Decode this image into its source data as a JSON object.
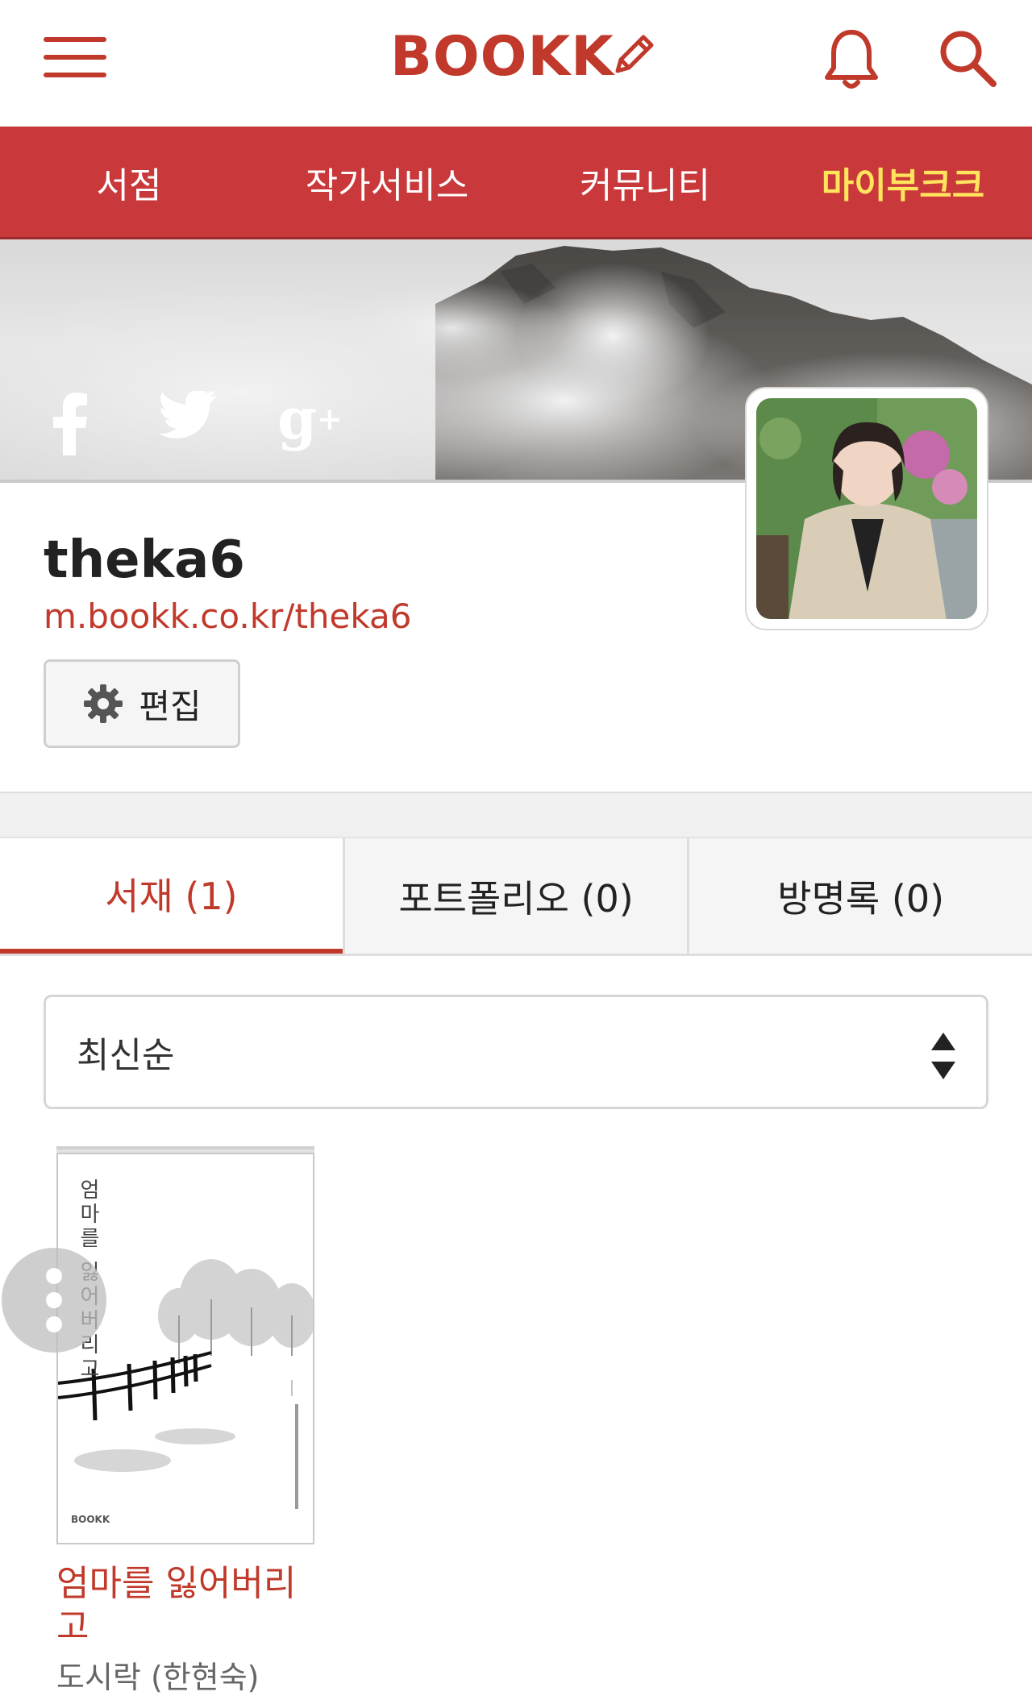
{
  "header": {
    "logo_text": "BOOKK",
    "menu_icon": "hamburger-menu-icon",
    "notification_icon": "bell-icon",
    "search_icon": "search-icon",
    "brand_color": "#c0392b"
  },
  "nav": {
    "items": [
      {
        "label": "서점"
      },
      {
        "label": "작가서비스"
      },
      {
        "label": "커뮤니티"
      },
      {
        "label": "마이부크크",
        "active": true
      }
    ],
    "bg_color": "#c9383a",
    "active_color": "#ffe45c"
  },
  "cover": {
    "social_icons": [
      "facebook-icon",
      "twitter-icon",
      "google-plus-icon"
    ]
  },
  "profile": {
    "username": "theka6",
    "url": "m.bookk.co.kr/theka6",
    "edit_label": "편집",
    "edit_icon": "gear-icon"
  },
  "tabs": [
    {
      "label": "서재 (1)",
      "active": true
    },
    {
      "label": "포트폴리오 (0)"
    },
    {
      "label": "방명록 (0)"
    }
  ],
  "sort": {
    "selected": "최신순",
    "icon": "sort-arrows-icon"
  },
  "books": [
    {
      "title": "엄마를 잃어버리고",
      "author": "도시락 (한현숙)",
      "cover_title": "엄마를 잃어버리고",
      "cover_brand": "BOOKK"
    }
  ]
}
